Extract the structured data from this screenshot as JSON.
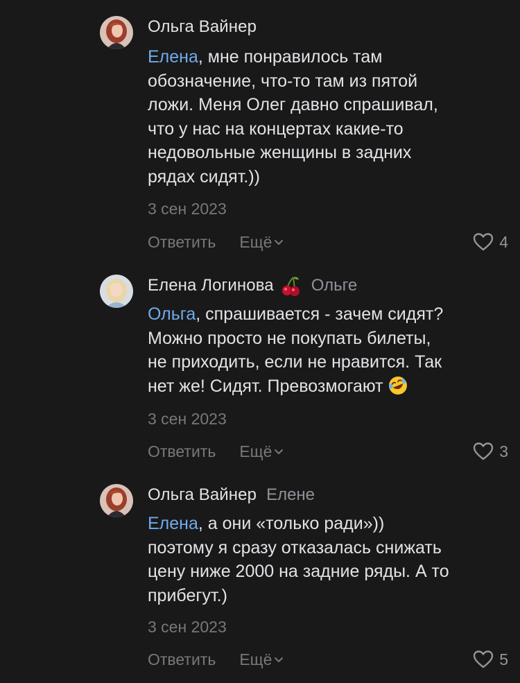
{
  "comments": [
    {
      "author": "Ольга Вайнер",
      "reply_to": "",
      "mention": "Елена",
      "text": ", мне понравилось там\nобозначение, что-то там из пятой\nложи. Меня Олег давно спрашивал,\nчто у нас на концертах какие-то\nнедовольные женщины в задних\nрядах сидят.))",
      "date": "3 сен 2023",
      "reply_label": "Ответить",
      "more_label": "Ещё",
      "likes": "4"
    },
    {
      "author": "Елена Логинова",
      "reply_to": "Ольге",
      "mention": "Ольга",
      "text": ", спрашивается - зачем сидят?\nМожно просто не покупать билеты,\nне приходить, если не нравится. Так\nнет же! Сидят. Превозмогают",
      "date": "3 сен 2023",
      "reply_label": "Ответить",
      "more_label": "Ещё",
      "likes": "3"
    },
    {
      "author": "Ольга Вайнер",
      "reply_to": "Елене",
      "mention": "Елена",
      "text": ", а они «только ради»))\nпоэтому я сразу отказалась снижать\nцену ниже 2000 на задние ряды. А то\nприбегут.)",
      "date": "3 сен 2023",
      "reply_label": "Ответить",
      "more_label": "Ещё",
      "likes": "5"
    }
  ],
  "icons": {
    "heart": "heart-icon",
    "chevron": "chevron-down-icon",
    "cherry": "cherry-icon",
    "rofl": "rofl-emoji-icon"
  },
  "colors": {
    "background": "#19191a",
    "text": "#e1e3e6",
    "mention": "#71aaeb",
    "secondary": "#76787a"
  }
}
